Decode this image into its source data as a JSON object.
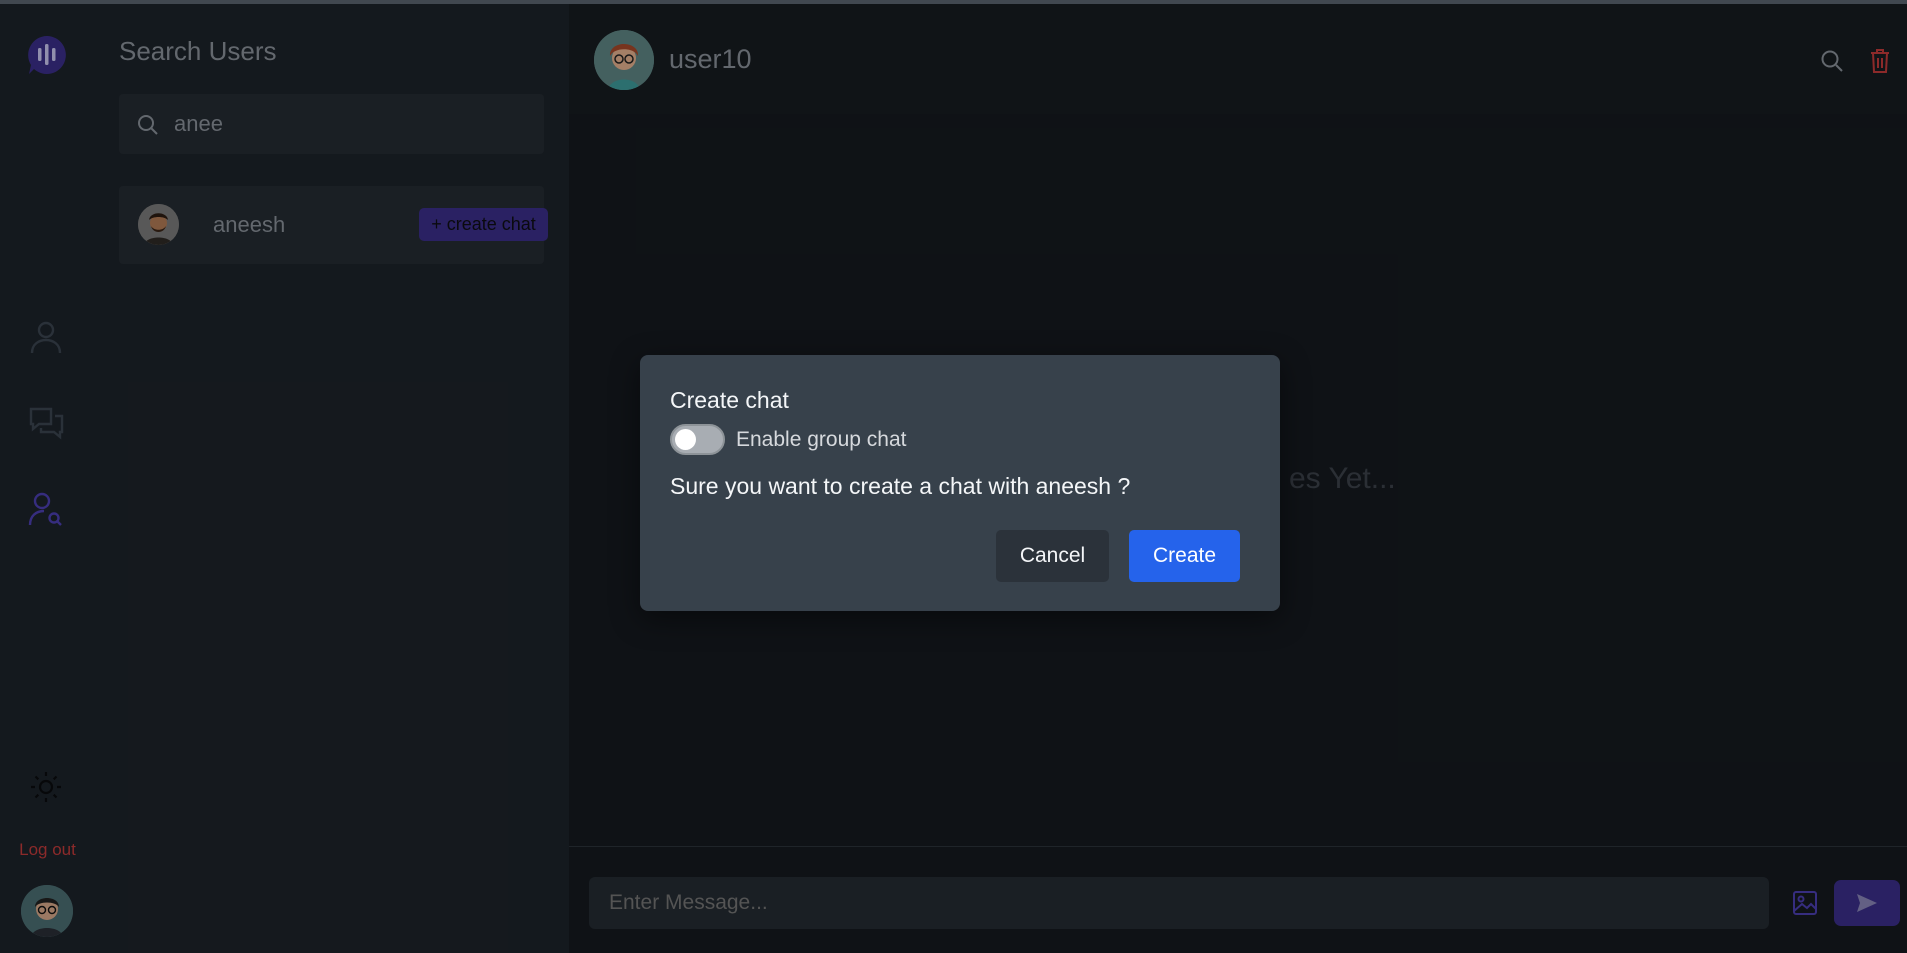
{
  "colors": {
    "accent": "#3b2f8a",
    "accent_icon": "#4c3fb0",
    "danger": "#c23b3b",
    "primary_button": "#2563eb",
    "modal_bg": "#37414b",
    "rail_bg": "#1d232a",
    "chat_bg": "#151a1f"
  },
  "rail": {
    "logo_icon": "chat-bubble-logo-icon",
    "nav": [
      {
        "icon": "user-icon",
        "active": false
      },
      {
        "icon": "chats-icon",
        "active": false
      },
      {
        "icon": "search-users-icon",
        "active": true
      }
    ],
    "theme_icon": "sun-icon",
    "logout_label": "Log out",
    "avatar_icon": "user-avatar"
  },
  "search_panel": {
    "title": "Search Users",
    "search": {
      "value": "anee",
      "icon": "search-icon"
    },
    "results": [
      {
        "name": "aneesh",
        "button_label": "+ create chat"
      }
    ]
  },
  "chat": {
    "header": {
      "name": "user10"
    },
    "empty_text": "es Yet...",
    "message_input": {
      "placeholder": "Enter Message..."
    }
  },
  "modal": {
    "title": "Create chat",
    "toggle_label": "Enable group chat",
    "toggle_on": false,
    "question": "Sure you want to create a chat with aneesh ?",
    "cancel_label": "Cancel",
    "create_label": "Create"
  }
}
